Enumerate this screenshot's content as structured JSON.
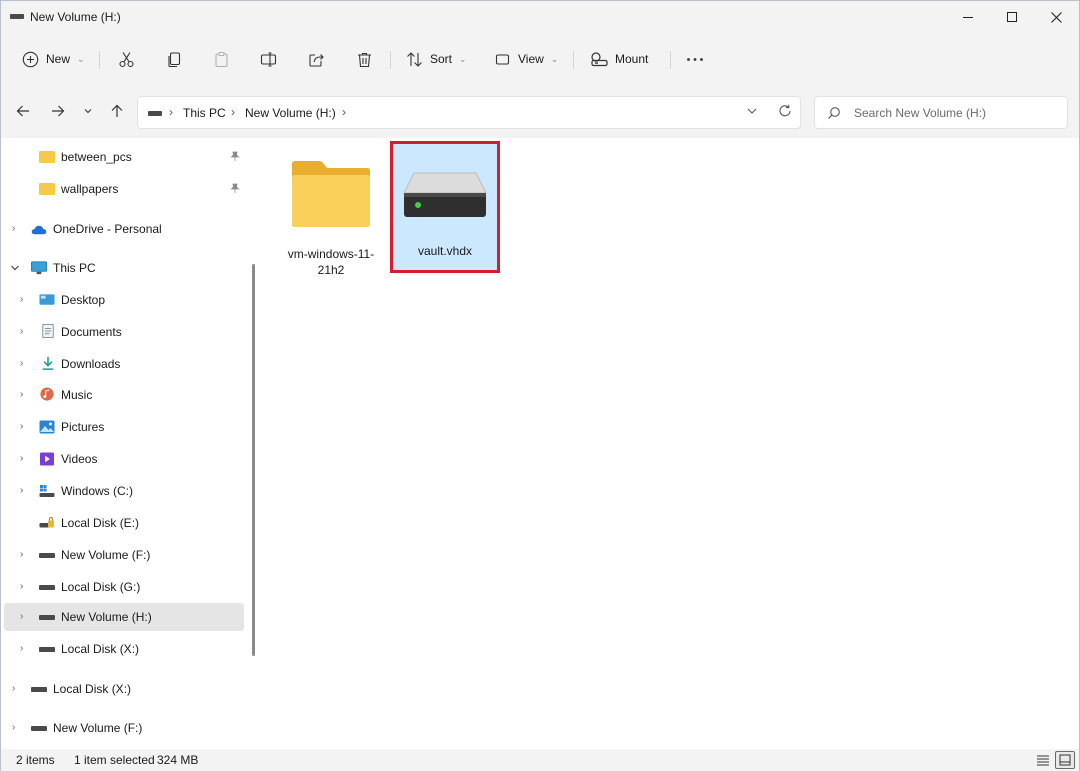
{
  "window": {
    "title": "New Volume (H:)"
  },
  "toolbar": {
    "new_label": "New",
    "sort_label": "Sort",
    "view_label": "View",
    "mount_label": "Mount"
  },
  "address": {
    "crumbs": [
      "This PC",
      "New Volume (H:)"
    ]
  },
  "search": {
    "placeholder": "Search New Volume (H:)"
  },
  "sidebar": {
    "items": [
      {
        "label": "between_pcs",
        "icon": "folder-icon",
        "pinned": true
      },
      {
        "label": "wallpapers",
        "icon": "folder-icon",
        "pinned": true
      },
      {
        "label": "OneDrive - Personal",
        "icon": "cloud-icon"
      },
      {
        "label": "This PC",
        "icon": "computer-icon"
      },
      {
        "label": "Desktop",
        "icon": "desktop-icon"
      },
      {
        "label": "Documents",
        "icon": "documents-icon"
      },
      {
        "label": "Downloads",
        "icon": "download-icon"
      },
      {
        "label": "Music",
        "icon": "music-icon"
      },
      {
        "label": "Pictures",
        "icon": "pictures-icon"
      },
      {
        "label": "Videos",
        "icon": "videos-icon"
      },
      {
        "label": "Windows (C:)",
        "icon": "windows-drive-icon"
      },
      {
        "label": "Local Disk (E:)",
        "icon": "locked-drive-icon"
      },
      {
        "label": "New Volume (F:)",
        "icon": "drive-icon"
      },
      {
        "label": "Local Disk (G:)",
        "icon": "drive-icon"
      },
      {
        "label": "New Volume (H:)",
        "icon": "drive-icon",
        "selected": true
      },
      {
        "label": "Local Disk (X:)",
        "icon": "drive-icon"
      },
      {
        "label": "Local Disk (X:)",
        "icon": "drive-icon"
      },
      {
        "label": "New Volume (F:)",
        "icon": "drive-icon"
      }
    ]
  },
  "files": [
    {
      "name": "vm-windows-11-21h2",
      "icon": "folder-icon"
    },
    {
      "name": "vault.vhdx",
      "icon": "virtual-disk-icon",
      "selected": true
    }
  ],
  "status": {
    "item_count": "2 items",
    "selection": "1 item selected",
    "size": "324 MB"
  },
  "colors": {
    "selection_bg": "#cce8ff",
    "highlight_border": "#d0202f",
    "folder": "#f7c948"
  }
}
